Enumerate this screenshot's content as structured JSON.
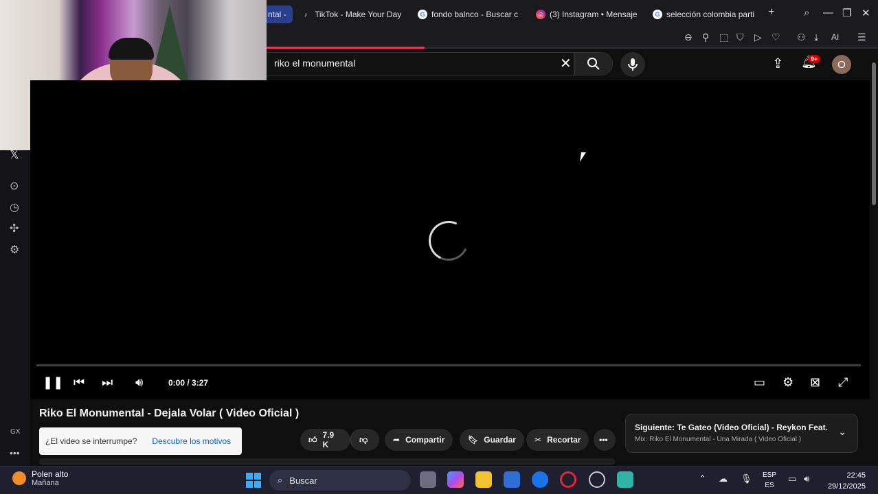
{
  "browser": {
    "tabs": [
      {
        "label": "ntal -",
        "icon": "tab-partial-icon"
      },
      {
        "label": "TikTok - Make Your Day",
        "icon": "tiktok-icon"
      },
      {
        "label": "fondo balnco - Buscar c",
        "icon": "google-icon"
      },
      {
        "label": "(3) Instagram • Mensaje",
        "icon": "instagram-icon"
      },
      {
        "label": "selección colombia parti",
        "icon": "google-icon"
      }
    ],
    "new_tab_symbol": "+",
    "ai_label": "AI",
    "gx_label": "GX",
    "accent_color": "#e8355a"
  },
  "youtube": {
    "search_value": "riko el monumental",
    "notification_badge": "9+",
    "avatar_letter": "O",
    "video": {
      "state": "loading",
      "time": "0:00 / 3:27",
      "title": "Riko El Monumental - Dejala Volar ( Video Oficial )"
    },
    "toast": {
      "text": "¿El video se interrumpe?",
      "link": "Descubre los motivos"
    },
    "actions": {
      "likes": "7.9 K",
      "share": "Compartir",
      "save": "Guardar",
      "clip": "Recortar"
    },
    "up_next": {
      "line1": "Siguiente: Te Gateo (Video Oficial) - Reykon Feat. Pi...",
      "line2": "Mix: Riko El Monumental - Una Mirada ( Video Oficial )"
    }
  },
  "taskbar": {
    "weather_title": "Polen alto",
    "weather_sub": "Mañana",
    "search_placeholder": "Buscar",
    "lang_top": "ESP",
    "lang_bottom": "ES",
    "time": "22:45",
    "date": "29/12/2025"
  }
}
